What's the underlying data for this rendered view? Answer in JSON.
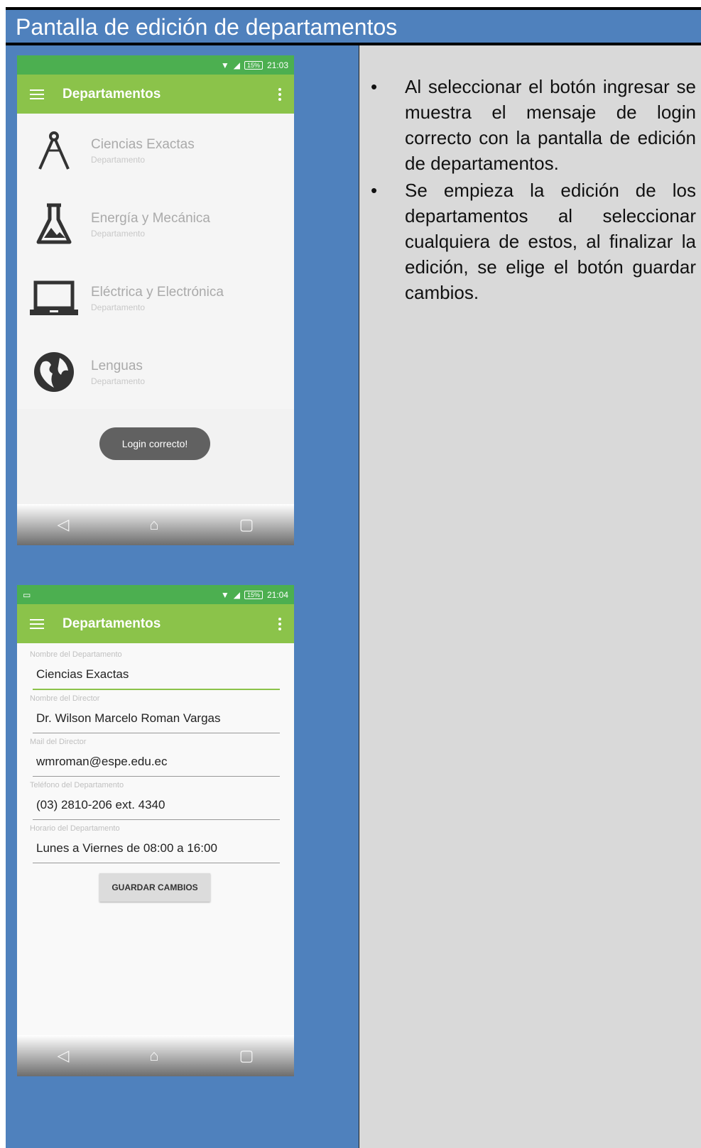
{
  "slide": {
    "title": "Pantalla de edición de departamentos",
    "bullets": [
      "Al seleccionar el botón ingresar se muestra el mensaje de login correcto con la pantalla de edición de departamentos.",
      "Se empieza la edición de los departamentos al seleccionar cualquiera de estos, al finalizar la edición, se elige el botón guardar cambios."
    ]
  },
  "phone1": {
    "status": {
      "battery": "15%",
      "time": "21:03"
    },
    "appbar_title": "Departamentos",
    "items": [
      {
        "title": "Ciencias Exactas",
        "subtitle": "Departamento",
        "icon": "compass-icon"
      },
      {
        "title": "Energía y Mecánica",
        "subtitle": "Departamento",
        "icon": "flask-icon"
      },
      {
        "title": "Eléctrica y Electrónica",
        "subtitle": "Departamento",
        "icon": "laptop-icon"
      },
      {
        "title": "Lenguas",
        "subtitle": "Departamento",
        "icon": "globe-icon"
      }
    ],
    "toast": "Login correcto!"
  },
  "phone2": {
    "status": {
      "battery": "15%",
      "time": "21:04"
    },
    "appbar_title": "Departamentos",
    "fields": [
      {
        "label": "Nombre del Departamento",
        "value": "Ciencias Exactas"
      },
      {
        "label": "Nombre del Director",
        "value": "Dr. Wilson Marcelo Roman Vargas"
      },
      {
        "label": "Mail del Director",
        "value": "wmroman@espe.edu.ec"
      },
      {
        "label": "Teléfono del Departamento",
        "value": "(03) 2810-206 ext. 4340"
      },
      {
        "label": "Horario del Departamento",
        "value": "Lunes a Viernes de 08:00 a 16:00"
      }
    ],
    "save_label": "GUARDAR CAMBIOS"
  },
  "colors": {
    "slide": "#4f81bd",
    "panel": "#d9d9d9",
    "status": "#4caf50",
    "appbar": "#8bc34a"
  }
}
